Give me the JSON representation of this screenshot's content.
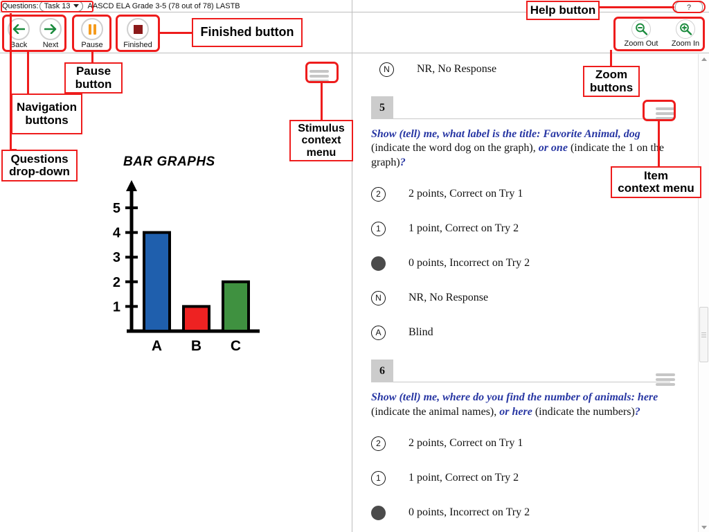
{
  "header": {
    "questions_label": "Questions:",
    "task_selected": "Task 13",
    "document_title": "AASCD ELA Grade 3-5 (78 out of 78) LASTB",
    "help_label": "?"
  },
  "toolbar": {
    "back_label": "Back",
    "next_label": "Next",
    "pause_label": "Pause",
    "finished_label": "Finished",
    "zoom_out_label": "Zoom Out",
    "zoom_in_label": "Zoom In"
  },
  "stimulus": {
    "title": "BAR GRAPHS",
    "context_menu_name": "Stimulus context menu"
  },
  "chart_data": {
    "type": "bar",
    "title": "BAR GRAPHS",
    "categories": [
      "A",
      "B",
      "C"
    ],
    "values": [
      4,
      1,
      2
    ],
    "colors": [
      "#1f5fad",
      "#ee2222",
      "#3f9140"
    ],
    "xlabel": "",
    "ylabel": "",
    "ylim": [
      0,
      5
    ],
    "yticks": [
      1,
      2,
      3,
      4,
      5
    ],
    "grid": false,
    "legend": "none"
  },
  "items": [
    {
      "number": "5",
      "question_parts": [
        {
          "text": "Show (tell) me, what label is the title: Favorite Animal, dog",
          "emphasis": true
        },
        {
          "text": " (indicate the word dog on the graph), ",
          "emphasis": false
        },
        {
          "text": "or one",
          "emphasis": true
        },
        {
          "text": " (indicate the 1 on the graph)",
          "emphasis": false
        },
        {
          "text": "?",
          "emphasis": true
        }
      ],
      "options": [
        {
          "mark": "2",
          "label": "2 points, Correct on Try 1",
          "selected": false
        },
        {
          "mark": "1",
          "label": "1 point, Correct on Try 2",
          "selected": false
        },
        {
          "mark": "0",
          "label": "0 points, Incorrect on Try 2",
          "selected": true
        },
        {
          "mark": "N",
          "label": "NR, No Response",
          "selected": false
        },
        {
          "mark": "A",
          "label": "Blind",
          "selected": false
        }
      ]
    },
    {
      "number": "6",
      "question_parts": [
        {
          "text": "Show (tell) me, where do you find the number of animals: here",
          "emphasis": true
        },
        {
          "text": " (indicate the animal names), ",
          "emphasis": false
        },
        {
          "text": "or here",
          "emphasis": true
        },
        {
          "text": " (indicate the numbers)",
          "emphasis": false
        },
        {
          "text": "?",
          "emphasis": true
        }
      ],
      "options": [
        {
          "mark": "2",
          "label": "2 points, Correct on Try 1",
          "selected": false
        },
        {
          "mark": "1",
          "label": "1 point, Correct on Try 2",
          "selected": false
        },
        {
          "mark": "0",
          "label": "0 points, Incorrect on Try 2",
          "selected": true
        }
      ]
    }
  ],
  "previous_item_tail": {
    "mark": "N",
    "label": "NR, No Response"
  },
  "annotations": {
    "questions_dropdown": "Questions\ndrop-down",
    "navigation_buttons": "Navigation\nbuttons",
    "pause_button": "Pause\nbutton",
    "finished_button": "Finished button",
    "stimulus_context_menu": "Stimulus\ncontext\nmenu",
    "help_button": "Help button",
    "zoom_buttons": "Zoom\nbuttons",
    "item_context_menu": "Item\ncontext menu"
  },
  "colors": {
    "annotation": "#ee1c1c",
    "emphasis_text": "#2736a3",
    "selected_radio": "#4b4b4b",
    "item_badge": "#cccccc"
  }
}
